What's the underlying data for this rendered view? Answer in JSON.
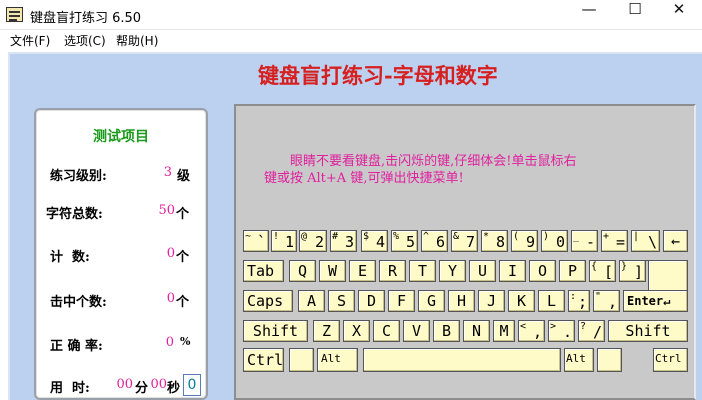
{
  "window": {
    "title": "键盘盲打练习 6.50",
    "minimize": "—",
    "maximize": "☐",
    "close": "✕"
  },
  "menu": [
    "文件(F)",
    "选项(C)",
    "帮助(H)"
  ],
  "heading": "键盘盲打练习-字母和数字",
  "stats": {
    "title": "测试项目",
    "level_label": "练习级别:",
    "level_value": "3",
    "level_unit": "级",
    "total_label": "字符总数:",
    "total_value": "50",
    "total_unit": "个",
    "count_label": "计  数:",
    "count_value": "0",
    "count_unit": "个",
    "hits_label": "击中个数:",
    "hits_value": "0",
    "hits_unit": "个",
    "accuracy_label": "正 确 率:",
    "accuracy_value": "0",
    "accuracy_unit": "%",
    "time_label": "用  时:",
    "time_min": "00",
    "time_min_unit": "分",
    "time_sec": "00",
    "time_sec_unit": "秒",
    "time_box": "0"
  },
  "hint": {
    "line1": "眼睛不要看键盘,击闪烁的键,仔细体会!单击鼠标右",
    "line2": "键或按 Alt+A 键,可弹出快捷菜单!"
  },
  "keyboard": {
    "row1": [
      {
        "shift": "~",
        "main": "`"
      },
      {
        "shift": "!",
        "main": "1"
      },
      {
        "shift": "@",
        "main": "2"
      },
      {
        "shift": "#",
        "main": "3"
      },
      {
        "shift": "$",
        "main": "4"
      },
      {
        "shift": "%",
        "main": "5"
      },
      {
        "shift": "^",
        "main": "6"
      },
      {
        "shift": "&",
        "main": "7"
      },
      {
        "shift": "*",
        "main": "8"
      },
      {
        "shift": "(",
        "main": "9"
      },
      {
        "shift": ")",
        "main": "0"
      },
      {
        "shift": "_",
        "main": "-"
      },
      {
        "shift": "+",
        "main": "="
      },
      {
        "shift": "|",
        "main": "\\"
      },
      {
        "shift": "",
        "main": "←"
      }
    ],
    "row2": [
      "Tab",
      "Q",
      "W",
      "E",
      "R",
      "T",
      "Y",
      "U",
      "I",
      "O",
      "P",
      {
        "shift": "{",
        "main": "["
      },
      {
        "shift": "}",
        "main": "]"
      }
    ],
    "row3": [
      "Caps",
      "A",
      "S",
      "D",
      "F",
      "G",
      "H",
      "J",
      "K",
      "L",
      {
        "shift": ":",
        "main": ";"
      },
      {
        "shift": "\"",
        "main": ","
      },
      "Enter↵"
    ],
    "row4": [
      "Shift",
      "Z",
      "X",
      "C",
      "V",
      "B",
      "N",
      "M",
      {
        "shift": "<",
        "main": ","
      },
      {
        "shift": ">",
        "main": "."
      },
      {
        "shift": "?",
        "main": "/"
      },
      "Shift"
    ],
    "row5": [
      "Ctrl",
      "",
      "Alt",
      "",
      "Alt",
      "",
      "Ctrl"
    ]
  }
}
